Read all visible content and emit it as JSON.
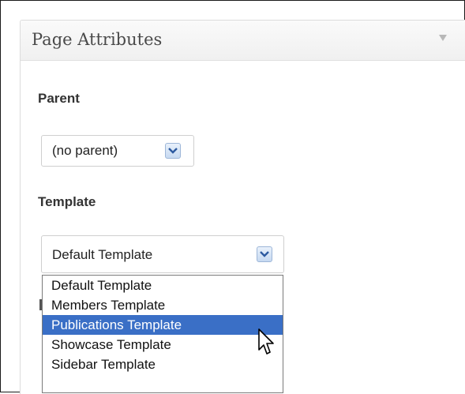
{
  "panel": {
    "title": "Page Attributes",
    "toggle_icon": "triangle-down-icon"
  },
  "parent": {
    "label": "Parent",
    "selected": "(no parent)"
  },
  "template": {
    "label": "Template",
    "selected": "Default Template",
    "options": [
      "Default Template",
      "Members Template",
      "Publications Template",
      "Showcase Template",
      "Sidebar Template"
    ],
    "highlighted": "Publications Template"
  },
  "colors": {
    "highlight": "#3a6fc6",
    "arrow_button": "#c6d9f1"
  }
}
